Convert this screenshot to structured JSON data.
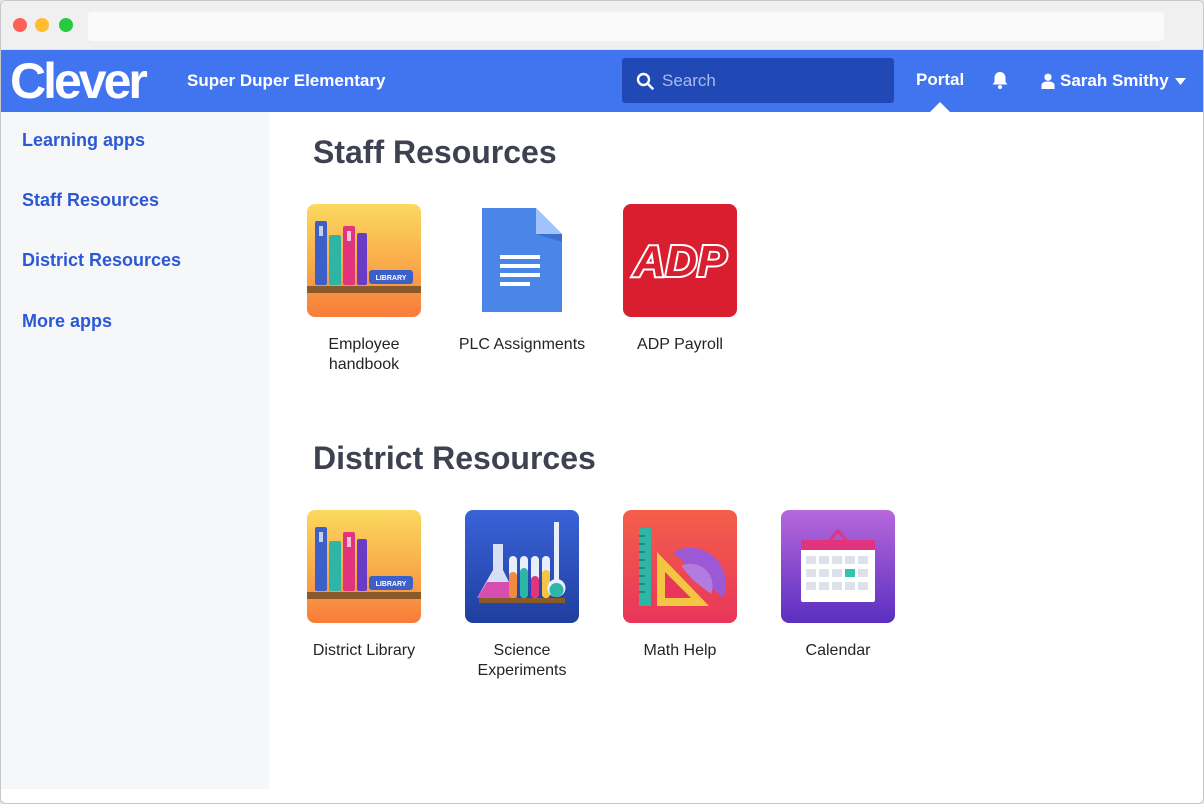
{
  "header": {
    "logo": "Clever",
    "school": "Super Duper Elementary",
    "search_placeholder": "Search",
    "portal_label": "Portal",
    "user_name": "Sarah Smithy"
  },
  "sidebar": {
    "items": [
      {
        "label": "Learning apps"
      },
      {
        "label": "Staff Resources"
      },
      {
        "label": "District Resources"
      },
      {
        "label": "More apps"
      }
    ]
  },
  "sections": [
    {
      "title": "Staff Resources",
      "apps": [
        {
          "label": "Employee handbook",
          "icon": "library-books-icon"
        },
        {
          "label": "PLC Assignments",
          "icon": "google-docs-icon"
        },
        {
          "label": "ADP Payroll",
          "icon": "adp-logo-icon"
        }
      ]
    },
    {
      "title": "District Resources",
      "apps": [
        {
          "label": "District Library",
          "icon": "library-books-icon"
        },
        {
          "label": "Science Experiments",
          "icon": "test-tubes-icon"
        },
        {
          "label": "Math Help",
          "icon": "protractor-ruler-icon"
        },
        {
          "label": "Calendar",
          "icon": "calendar-icon"
        }
      ]
    }
  ],
  "icon_text": {
    "library_tag": "LIBRARY",
    "adp": "ADP"
  },
  "colors": {
    "brand_blue": "#4175f0",
    "search_bg": "#2049b5",
    "link_blue": "#2b58d6",
    "heading": "#3d4150"
  }
}
